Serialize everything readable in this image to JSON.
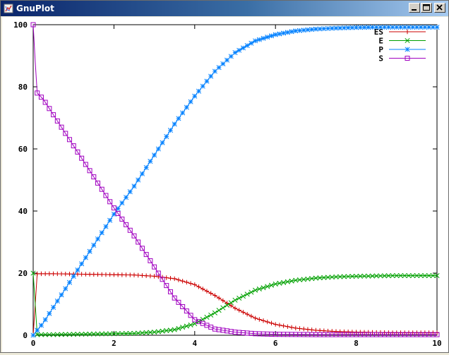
{
  "window": {
    "title": "GnuPlot",
    "controls": {
      "minimize": "minimize",
      "maximize": "maximize",
      "close": "close"
    }
  },
  "icons": {
    "app": "gnuplot-app-icon",
    "minimize": "minimize-icon",
    "maximize": "maximize-icon",
    "close": "close-icon"
  },
  "chart_data": {
    "type": "line",
    "title": "",
    "xlabel": "",
    "ylabel": "",
    "xlim": [
      0,
      10
    ],
    "ylim": [
      0,
      100
    ],
    "x_ticks": [
      0,
      2,
      4,
      6,
      8,
      10
    ],
    "y_ticks": [
      0,
      20,
      40,
      60,
      80,
      100
    ],
    "grid": false,
    "legend_position": "top-right",
    "series": [
      {
        "name": "ES",
        "color": "#cc0000",
        "marker": "plus",
        "points": [
          [
            0,
            0
          ],
          [
            0.1,
            19.8
          ],
          [
            0.5,
            19.8
          ],
          [
            1,
            19.7
          ],
          [
            1.5,
            19.6
          ],
          [
            2,
            19.5
          ],
          [
            2.5,
            19.4
          ],
          [
            3,
            19.0
          ],
          [
            3.5,
            18.2
          ],
          [
            4,
            16.3
          ],
          [
            4.5,
            12.8
          ],
          [
            5,
            8.7
          ],
          [
            5.5,
            5.5
          ],
          [
            6,
            3.5
          ],
          [
            6.5,
            2.3
          ],
          [
            7,
            1.6
          ],
          [
            7.5,
            1.2
          ],
          [
            8,
            1.0
          ],
          [
            8.5,
            0.9
          ],
          [
            9,
            0.8
          ],
          [
            9.5,
            0.8
          ],
          [
            10,
            0.8
          ]
        ]
      },
      {
        "name": "E",
        "color": "#00a000",
        "marker": "cross",
        "points": [
          [
            0,
            20
          ],
          [
            0.1,
            0.2
          ],
          [
            0.5,
            0.2
          ],
          [
            1,
            0.3
          ],
          [
            1.5,
            0.4
          ],
          [
            2,
            0.5
          ],
          [
            2.5,
            0.6
          ],
          [
            3,
            1.0
          ],
          [
            3.5,
            1.8
          ],
          [
            4,
            3.7
          ],
          [
            4.5,
            7.2
          ],
          [
            5,
            11.3
          ],
          [
            5.5,
            14.5
          ],
          [
            6,
            16.5
          ],
          [
            6.5,
            17.7
          ],
          [
            7,
            18.4
          ],
          [
            7.5,
            18.8
          ],
          [
            8,
            19.0
          ],
          [
            8.5,
            19.1
          ],
          [
            9,
            19.2
          ],
          [
            9.5,
            19.2
          ],
          [
            10,
            19.2
          ]
        ]
      },
      {
        "name": "P",
        "color": "#0080ff",
        "marker": "star",
        "points": [
          [
            0,
            0
          ],
          [
            0.25,
            4
          ],
          [
            0.5,
            9
          ],
          [
            1,
            19
          ],
          [
            1.5,
            29
          ],
          [
            2,
            39
          ],
          [
            2.5,
            48
          ],
          [
            3,
            58
          ],
          [
            3.5,
            68
          ],
          [
            4,
            77
          ],
          [
            4.5,
            85
          ],
          [
            5,
            91
          ],
          [
            5.5,
            94.8
          ],
          [
            6,
            96.8
          ],
          [
            6.5,
            98
          ],
          [
            7,
            98.6
          ],
          [
            7.5,
            98.9
          ],
          [
            8,
            99.1
          ],
          [
            8.5,
            99.2
          ],
          [
            9,
            99.2
          ],
          [
            9.5,
            99.2
          ],
          [
            10,
            99.2
          ]
        ]
      },
      {
        "name": "S",
        "color": "#a000c0",
        "marker": "box",
        "points": [
          [
            0,
            100
          ],
          [
            0.05,
            88
          ],
          [
            0.1,
            78
          ],
          [
            0.25,
            76
          ],
          [
            0.5,
            71
          ],
          [
            1,
            61
          ],
          [
            1.5,
            51
          ],
          [
            2,
            41
          ],
          [
            2.5,
            32
          ],
          [
            3,
            22
          ],
          [
            3.5,
            12
          ],
          [
            4,
            5
          ],
          [
            4.5,
            2
          ],
          [
            5,
            1
          ],
          [
            5.5,
            0.5
          ],
          [
            6,
            0.3
          ],
          [
            7,
            0.2
          ],
          [
            8,
            0.2
          ],
          [
            9,
            0.2
          ],
          [
            10,
            0.2
          ]
        ]
      }
    ]
  }
}
